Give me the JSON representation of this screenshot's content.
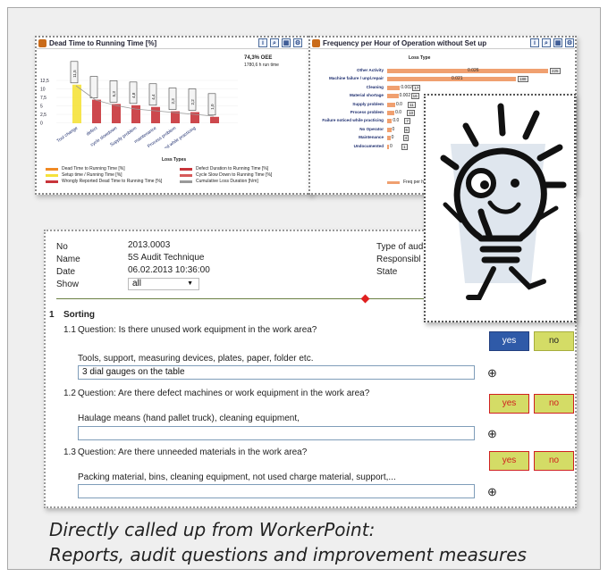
{
  "chart1": {
    "title": "Dead Time to Running Time [%]",
    "oee": "74,3% OEE",
    "runtime": "1780,6 h run time",
    "y_ticks": [
      "12,5",
      "10",
      "7,5",
      "5",
      "2,5",
      "0"
    ],
    "categories": [
      "Tool change",
      "defect",
      "cycle slowdown",
      "Supply problem",
      "maintenance",
      "Process problem",
      "Failure noticed while practicing"
    ],
    "bar_labels": [
      "11,5",
      "",
      "5,3",
      "4,8",
      "4,4",
      "2,3",
      "2,2",
      "1,0"
    ],
    "xlabel": "Loss Types",
    "legend": [
      "Dead Time to Running Time [%]",
      "Setup time / Running Time [%]",
      "Wrongly Reported Dead Time to Running Time [%]",
      "Defect Duration to Running Time [%]",
      "Cycle Slow Down to Running Time [%]",
      "Cumulative Loss Duration [h/m]"
    ],
    "colors": {
      "orange": "#f08a24",
      "yellow": "#f5e23a",
      "red": "#c8343a",
      "gray": "#999999"
    }
  },
  "chart2": {
    "title": "Frequency per Hour of Operation without Set up",
    "header": "Loss Type",
    "rows": [
      {
        "label": "Other Activity",
        "value": "0.026",
        "count": "225",
        "frac": 1.0
      },
      {
        "label": "Machine failure / unpl.repair",
        "value": "0.021",
        "count": "188",
        "frac": 0.8
      },
      {
        "label": "Cleaning",
        "value": "0.002",
        "count": "17",
        "frac": 0.08
      },
      {
        "label": "Material shortage",
        "value": "0.002",
        "count": "16",
        "frac": 0.07
      },
      {
        "label": "Supply problem",
        "value": "0.0",
        "count": "11",
        "frac": 0.05
      },
      {
        "label": "Process problem",
        "value": "0.0",
        "count": "10",
        "frac": 0.045
      },
      {
        "label": "Failure noticed while practicing",
        "value": "0.0",
        "count": "7",
        "frac": 0.03
      },
      {
        "label": "No Operator",
        "value": "0",
        "count": "6",
        "frac": 0.025
      },
      {
        "label": "Maintenance",
        "value": "0",
        "count": "4",
        "frac": 0.02
      },
      {
        "label": "Undocumented",
        "value": "0",
        "count": "1",
        "frac": 0.01
      }
    ],
    "legend": "Freq per h"
  },
  "audit": {
    "fields": [
      {
        "label": "No",
        "value": "2013.0003"
      },
      {
        "label": "Name",
        "value": "5S Audit Technique"
      },
      {
        "label": "Date",
        "value": "06.02.2013 10:36:00"
      },
      {
        "label": "Show",
        "value": "all"
      }
    ],
    "right_fields": [
      "Type of aud",
      "Responsibl",
      "State"
    ],
    "section_no": "1",
    "section_title": "Sorting",
    "questions": [
      {
        "number": "1.1",
        "text": "Question: Is there unused work equipment in the work area?",
        "hint": "Tools, support, measuring devices, plates, paper, folder etc.",
        "answer": "3 dial gauges on the table",
        "yes": "yes",
        "no": "no",
        "icon": "⊕"
      },
      {
        "number": "1.2",
        "text": "Question: Are there defect machines or work equipment in the work area?",
        "hint": "Haulage means (hand pallet truck), cleaning equipment,",
        "answer": "",
        "yes": "yes",
        "no": "no",
        "icon": "⊕"
      },
      {
        "number": "1.3",
        "text": "Question: Are there unneeded materials in the work area?",
        "hint": "Packing material, bins, cleaning equipment, not used charge material, support,...",
        "answer": "",
        "yes": "yes",
        "no": "no",
        "icon": "⊕"
      }
    ]
  },
  "caption": {
    "line1": "Directly called up from WorkerPoint:",
    "line2": "Reports, audit questions and improvement measures"
  }
}
